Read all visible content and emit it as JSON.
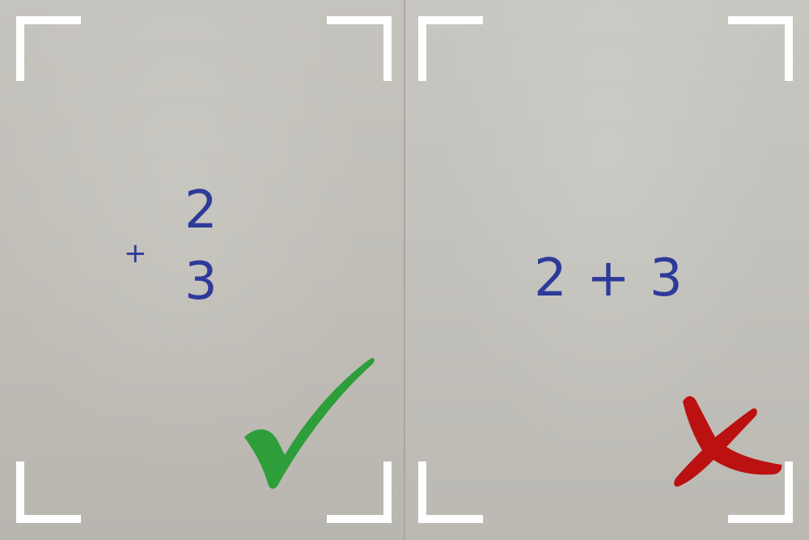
{
  "panels": [
    {
      "verdict": "correct",
      "verdict_icon": "checkmark-icon",
      "verdict_color": "#2e9e3a",
      "handwriting": {
        "operator": "+",
        "top": "2",
        "bottom": "3"
      }
    },
    {
      "verdict": "incorrect",
      "verdict_icon": "cross-icon",
      "verdict_color": "#bb1111",
      "handwriting": {
        "expression": "2 + 3"
      }
    }
  ],
  "colors": {
    "ink": "#2d3a9a",
    "frame": "#ffffff",
    "paper": "#c2c0ba"
  }
}
